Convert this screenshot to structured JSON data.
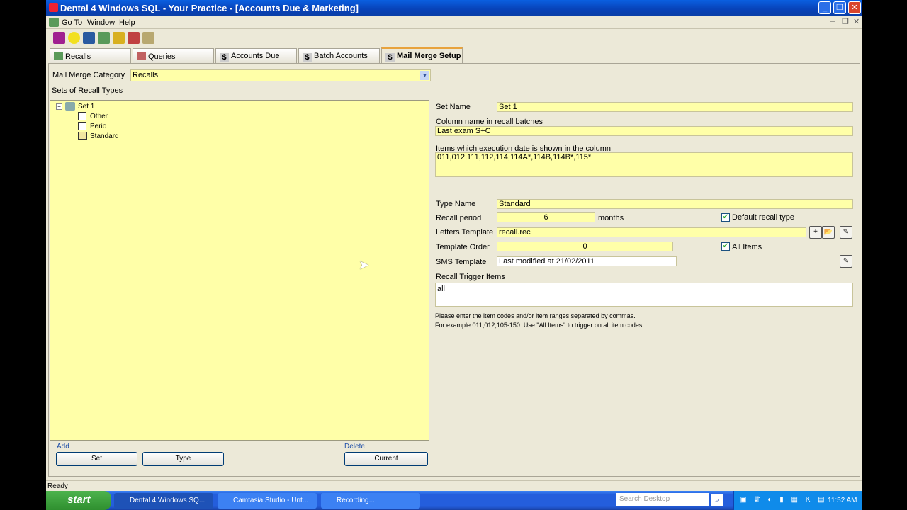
{
  "window": {
    "title": "Dental 4 Windows SQL - Your Practice - [Accounts Due & Marketing]"
  },
  "menu": [
    "Go To",
    "Window",
    "Help"
  ],
  "toolbar_icons": [
    "appointments-icon",
    "smiley-icon",
    "calculator-icon",
    "recalls-icon",
    "accounts-icon",
    "hierarchy-icon",
    "tools-icon"
  ],
  "tabs": [
    {
      "label": "Recalls",
      "icon": "recalls-icon"
    },
    {
      "label": "Queries",
      "icon": "queries-icon"
    },
    {
      "label": "Accounts Due",
      "icon": "dollar-icon"
    },
    {
      "label": "Batch Accounts",
      "icon": "dollar-icon"
    },
    {
      "label": "Mail Merge Setup",
      "icon": "dollar-icon",
      "active": true
    }
  ],
  "category": {
    "label": "Mail Merge Category",
    "value": "Recalls"
  },
  "sets_label": "Sets of Recall Types",
  "tree": {
    "root": "Set 1",
    "children": [
      "Other",
      "Perio",
      "Standard"
    ]
  },
  "form": {
    "set_name_label": "Set Name",
    "set_name": "Set 1",
    "column_label": "Column name in recall batches",
    "column_value": "Last exam S+C",
    "items_label": "Items which execution date is shown in the column",
    "items_value": "011,012,111,112,114,114A*,114B,114B*,115*",
    "type_name_label": "Type Name",
    "type_name": "Standard",
    "recall_period_label": "Recall period",
    "recall_period": "6",
    "months": "months",
    "default_recall_label": "Default recall type",
    "default_recall_checked": true,
    "letters_label": "Letters Template",
    "letters_value": "recall.rec",
    "order_label": "Template Order",
    "order_value": "0",
    "all_items_label": "All Items",
    "all_items_checked": true,
    "sms_label": "SMS Template",
    "sms_value": "Last modified at 21/02/2011",
    "trigger_label": "Recall Trigger Items",
    "trigger_value": "all",
    "help1": "Please enter the item codes and/or item ranges separated by commas.",
    "help2": "For example 011,012,105-150. Use \"All Items\" to trigger on all item codes."
  },
  "buttons": {
    "add_group": "Add",
    "set": "Set",
    "type": "Type",
    "delete_group": "Delete",
    "current": "Current"
  },
  "status": "Ready",
  "taskbar": {
    "start": "start",
    "tasks": [
      "Dental 4 Windows SQ...",
      "Camtasia Studio - Unt...",
      "Recording..."
    ],
    "search_placeholder": "Search Desktop",
    "clock": "11:52 AM"
  }
}
